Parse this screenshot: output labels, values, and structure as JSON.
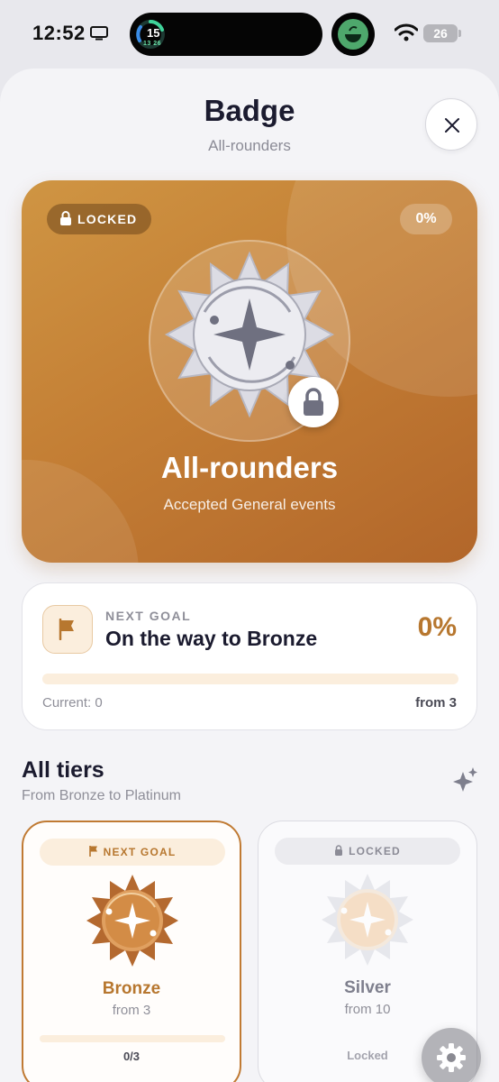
{
  "status_bar": {
    "time": "12:52",
    "activity_main": "15",
    "activity_sub": "13 26",
    "battery": "26"
  },
  "header": {
    "title": "Badge",
    "subtitle": "All-rounders"
  },
  "hero": {
    "locked_label": "LOCKED",
    "percent": "0%",
    "badge_name": "All-rounders",
    "description": "Accepted General events",
    "gradient_start": "#cf9543",
    "gradient_end": "#b2662a"
  },
  "next_goal": {
    "eyebrow": "NEXT GOAL",
    "title": "On the way to Bronze",
    "percent": "0%",
    "progress": 0,
    "current": "Current: 0",
    "from": "from 3"
  },
  "tiers": {
    "title": "All tiers",
    "subtitle": "From Bronze to Platinum",
    "items": [
      {
        "tag": "NEXT GOAL",
        "name": "Bronze",
        "from": "from 3",
        "progress_text": "0/3",
        "progress": 0,
        "color": "#b7772f"
      },
      {
        "tag": "LOCKED",
        "name": "Silver",
        "from": "from 10",
        "status": "Locked",
        "color": "#8b8b96"
      }
    ]
  },
  "icons": {
    "close": "close-icon",
    "lock": "lock-icon",
    "flag": "flag-icon",
    "sparkle": "sparkles-icon",
    "settings": "gear-icon"
  }
}
